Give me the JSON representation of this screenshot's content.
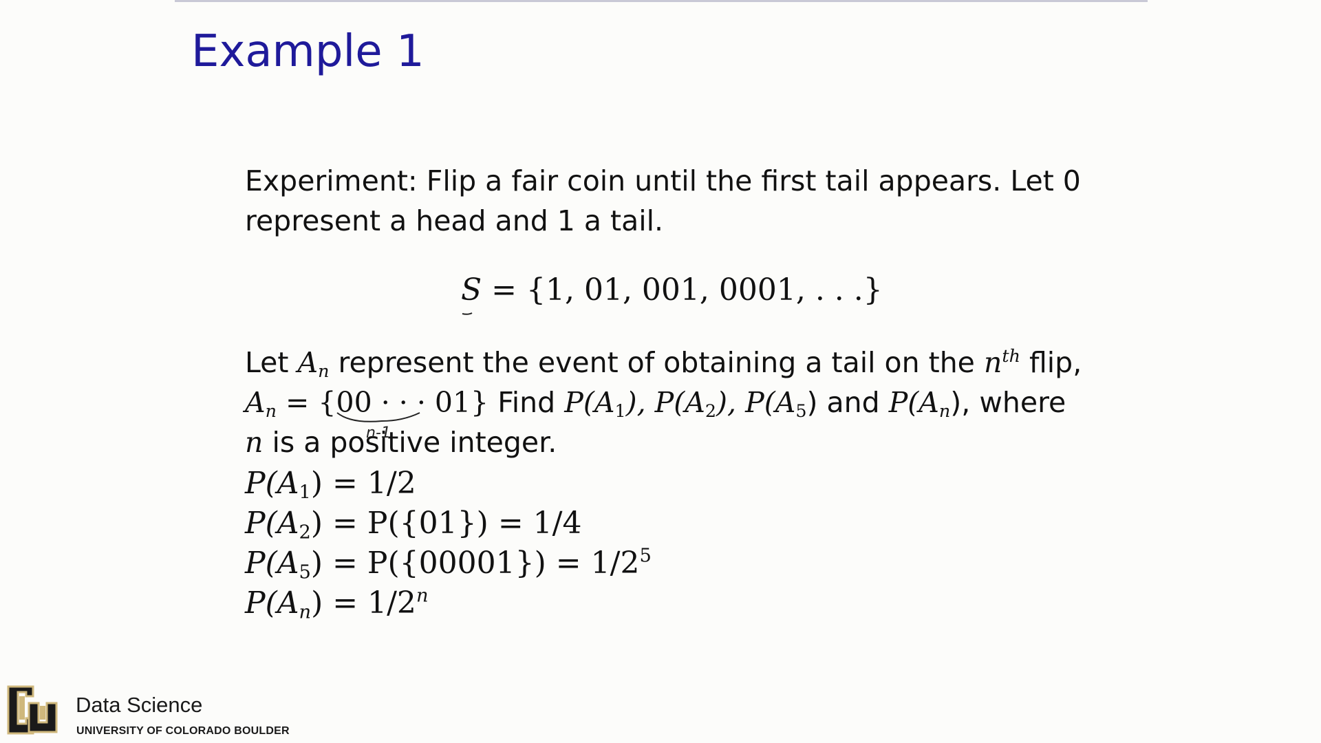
{
  "title": "Example 1",
  "intro": {
    "line1": "Experiment: Flip a fair coin until the first tail appears. Let 0",
    "line2": "represent a head and 1 a tail."
  },
  "sample_space": {
    "lhs": "S",
    "rhs": "= {1, 01, 001, 0001, . . .}"
  },
  "event": {
    "let": "Let",
    "A": "A",
    "n": "n",
    "desc": " represent the event of obtaining a tail on the ",
    "nth_n": "n",
    "nth_sup": "th",
    "flip": " flip,",
    "set_eq": " = {00 · · · 01}",
    "find": " Find ",
    "p1": "P(A",
    "s1": "1",
    "p2": "), P(A",
    "s2": "2",
    "p5": "), P(A",
    "s5": "5",
    "and": ") and ",
    "pn": "P(A",
    "sn": "n",
    "where": "), where",
    "line3_n": "n",
    "line3_rest": " is a positive integer."
  },
  "answers": [
    {
      "lhs_p": "P(A",
      "sub": "1",
      "rhs": ") = 1/2",
      "sup": ""
    },
    {
      "lhs_p": "P(A",
      "sub": "2",
      "rhs": ") = P({01}) = 1/4",
      "sup": ""
    },
    {
      "lhs_p": "P(A",
      "sub": "5",
      "rhs": ") = P({00001}) = 1/2",
      "sup": "5"
    },
    {
      "lhs_p": "P(A",
      "sub": "n",
      "rhs": ") = 1/2",
      "sup": "n"
    }
  ],
  "annotation": "n-1",
  "branding": {
    "name": "Data Science",
    "university": "UNIVERSITY OF COLORADO BOULDER"
  },
  "colors": {
    "title": "#1f1a9a",
    "logo_gold": "#cfb87c",
    "logo_black": "#1a1a1a"
  }
}
